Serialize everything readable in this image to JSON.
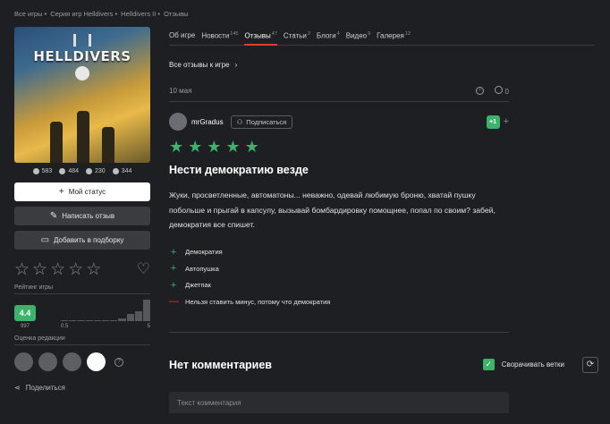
{
  "breadcrumb": [
    "Все игры",
    "Серия игр Helldivers",
    "Helldivers II",
    "Отзывы"
  ],
  "game": {
    "cover_title": "HELLDIVERS",
    "stats": [
      {
        "icon": "clock-icon",
        "value": "583"
      },
      {
        "icon": "gamepad-icon",
        "value": "484"
      },
      {
        "icon": "hand-icon",
        "value": "230"
      },
      {
        "icon": "flag-icon",
        "value": "344"
      }
    ]
  },
  "actions": {
    "status_label": "Мой статус",
    "write_review_label": "Написать отзыв",
    "add_collection_label": "Добавить в подборку",
    "share_label": "Поделиться"
  },
  "rating": {
    "label": "Рейтинг игры",
    "score": "4.4",
    "count": "997",
    "axis_min": "0.5",
    "axis_max": "5",
    "histogram": [
      0.04,
      0.02,
      0.03,
      0.03,
      0.04,
      0.05,
      0.06,
      0.12,
      0.35,
      0.45,
      1.0
    ],
    "editors_label": "Оценка редакции"
  },
  "tabs": [
    {
      "label": "Об игре",
      "count": ""
    },
    {
      "label": "Новости",
      "count": "145"
    },
    {
      "label": "Отзывы",
      "count": "47",
      "active": true
    },
    {
      "label": "Статьи",
      "count": "2"
    },
    {
      "label": "Блоги",
      "count": "4"
    },
    {
      "label": "Видео",
      "count": "9"
    },
    {
      "label": "Галерея",
      "count": "12"
    }
  ],
  "review": {
    "all_reviews_link": "Все отзывы к игре",
    "date": "10 мая",
    "comments_count": "0",
    "author": "mrGradus",
    "subscribe_label": "Подписаться",
    "plus_label": "+1",
    "stars": 5,
    "title": "Нести демократию везде",
    "body": "Жуки, просветленные, автоматоны... неважно, одевай любимую броню, хватай пушку побольше и прыгай в капсулу, вызывай бомбардировку помощнее, попал по своим? забей, демократия все спишет.",
    "pros": [
      "Демократия",
      "Автопушка",
      "Джетпак"
    ],
    "cons": [
      "Нельзя ставить минус, потому что демократия"
    ]
  },
  "comments": {
    "title": "Нет комментариев",
    "collapse_label": "Сворачивать ветки",
    "input_placeholder": "Текст комментария"
  },
  "colors": {
    "accent": "#3bb36b",
    "active_tab": "#e13b3b",
    "background": "#1d1f22"
  }
}
